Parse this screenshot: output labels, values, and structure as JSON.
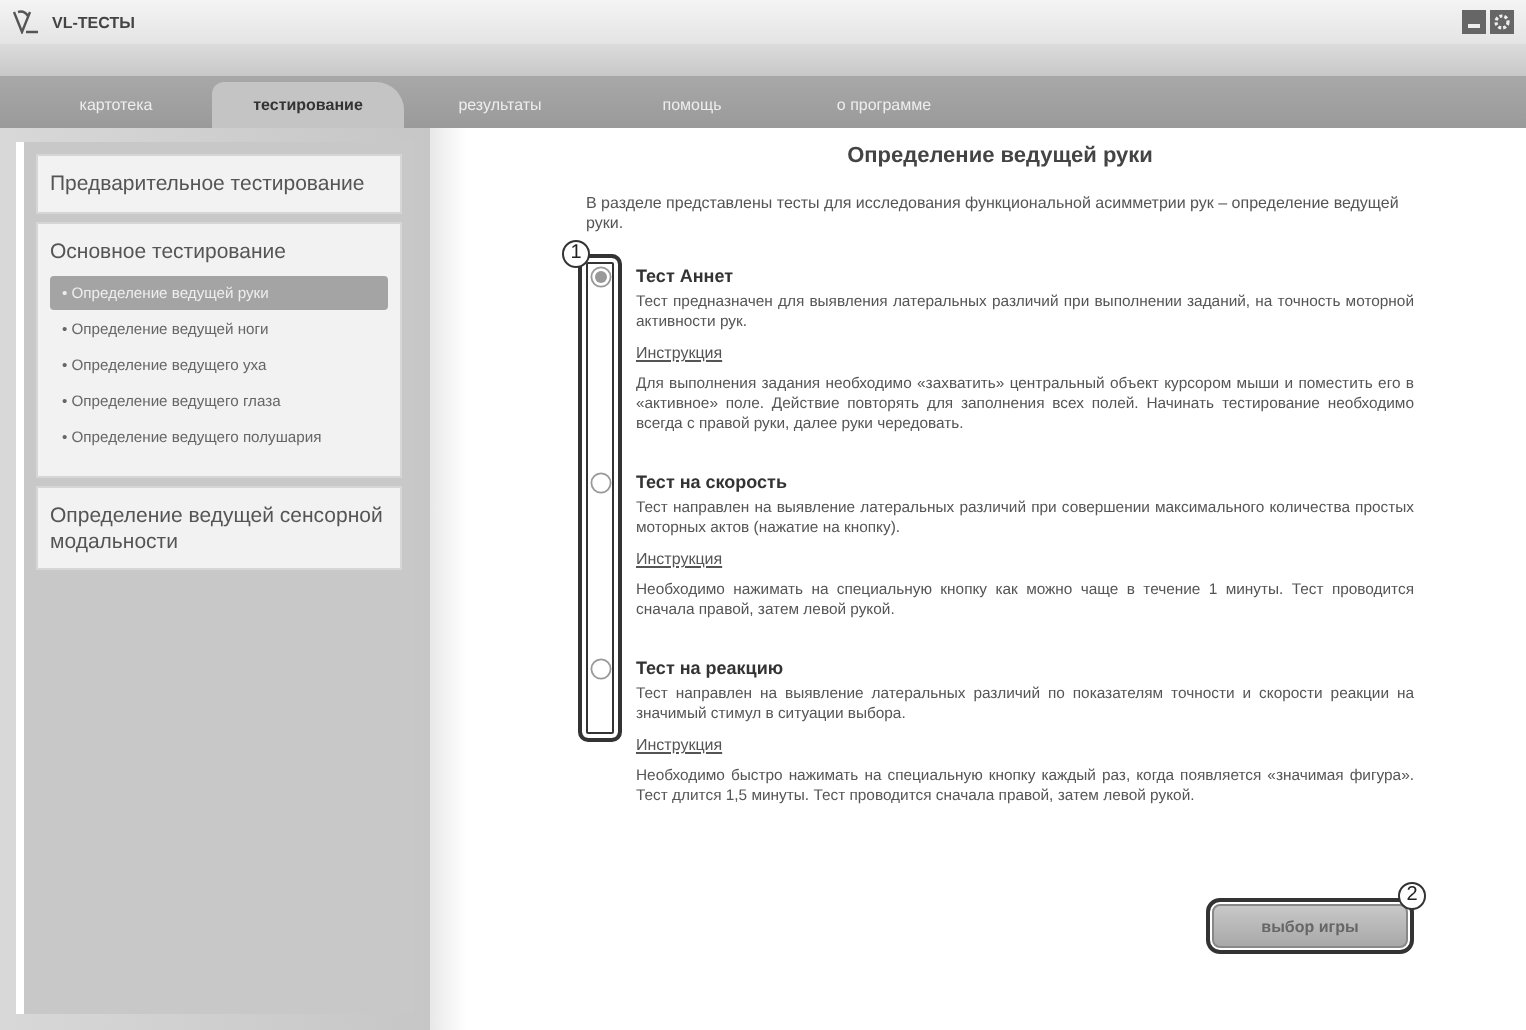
{
  "window": {
    "title": "VL-ТЕСТЫ"
  },
  "tabs": [
    {
      "label": "картотека",
      "selected": false
    },
    {
      "label": "тестирование",
      "selected": true
    },
    {
      "label": "результаты",
      "selected": false
    },
    {
      "label": "помощь",
      "selected": false
    },
    {
      "label": "о программе",
      "selected": false
    }
  ],
  "sidebar": {
    "sections": [
      {
        "title": "Предварительное тестирование"
      },
      {
        "title": "Основное тестирование",
        "items": [
          {
            "label": "• Определение ведущей руки",
            "selected": true
          },
          {
            "label": "• Определение ведущей ноги",
            "selected": false
          },
          {
            "label": "• Определение ведущего уха",
            "selected": false
          },
          {
            "label": "• Определение ведущего глаза",
            "selected": false
          },
          {
            "label": "• Определение ведущего полушария",
            "selected": false
          }
        ]
      },
      {
        "title": "Определение ведущей сенсорной модальности"
      }
    ]
  },
  "content": {
    "title": "Определение ведущей руки",
    "intro": "В разделе представлены тесты для исследования функциональной асимметрии  рук – определение ведущей руки.",
    "tests": [
      {
        "name": "Тест Аннет",
        "selected": true,
        "description": "Тест предназначен для выявления латеральных различий при выполнении заданий, на точность моторной активности рук.",
        "instruction_link": "Инструкция",
        "instruction": "Для выполнения задания необходимо «захватить» центральный объект  курсором мыши и поместить его в «активное» поле. Действие повторять для заполнения всех полей. Начинать тестирование необходимо всегда с правой руки, далее руки чередовать."
      },
      {
        "name": "Тест на скорость",
        "selected": false,
        "description": "Тест направлен на выявление латеральных различий при совершении максимального количества простых моторных актов (нажатие на кнопку).",
        "instruction_link": "Инструкция",
        "instruction": "Необходимо нажимать на специальную кнопку как можно чаще в течение 1 минуты. Тест проводится сначала правой, затем левой рукой."
      },
      {
        "name": "Тест на реакцию",
        "selected": false,
        "description": "Тест направлен на выявление латеральных различий  по показателям точности и скорости реакции на значимый стимул в ситуации выбора.",
        "instruction_link": "Инструкция",
        "instruction": "Необходимо быстро нажимать на специальную кнопку каждый раз, когда появляется «значимая фигура». Тест длится 1,5 минуты. Тест проводится сначала правой, затем левой рукой."
      }
    ]
  },
  "button": "выбор игры",
  "callouts": [
    "1",
    "2"
  ]
}
